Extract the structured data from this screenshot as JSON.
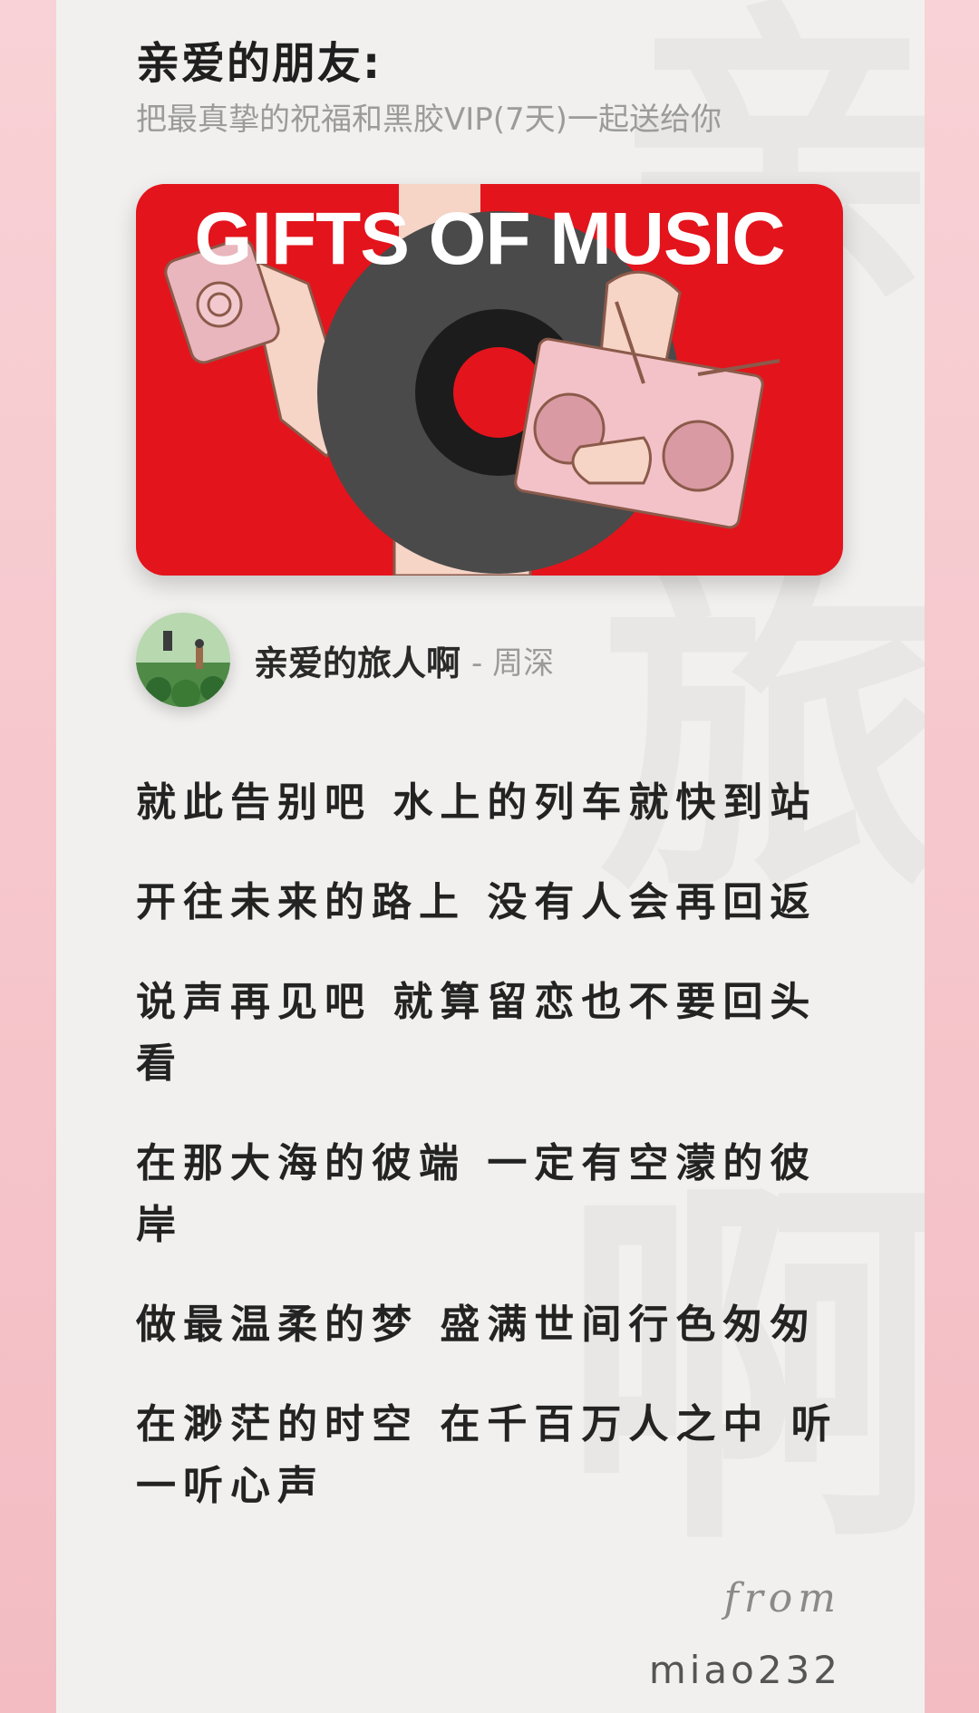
{
  "header": {
    "title": "亲爱的朋友:",
    "subtitle": "把最真挚的祝福和黑胶VIP(7天)一起送给你"
  },
  "banner": {
    "title": "GIFTS OF MUSIC",
    "icon": "vinyl-record-gift-illustration",
    "colors": {
      "background": "#e3141c",
      "record": "#4a4a4a",
      "label": "#e3141c",
      "boombox": "#f2c2c8"
    }
  },
  "song": {
    "title": "亲爱的旅人啊",
    "artist": "- 周深",
    "cover_icon": "album-cover"
  },
  "lyrics": [
    "就此告别吧 水上的列车就快到站",
    "开往未来的路上 没有人会再回返",
    "说声再见吧 就算留恋也不要回头看",
    "在那大海的彼端 一定有空濛的彼岸",
    "做最温柔的梦 盛满世间行色匆匆",
    "在渺茫的时空 在千百万人之中 听一听心声"
  ],
  "footer": {
    "from_label": "from",
    "sender": "miao232"
  },
  "colors": {
    "page_background": "#f4c5cb",
    "card_background": "#f1f0ee",
    "text_primary": "#232323",
    "text_secondary": "#9b9b9b"
  }
}
